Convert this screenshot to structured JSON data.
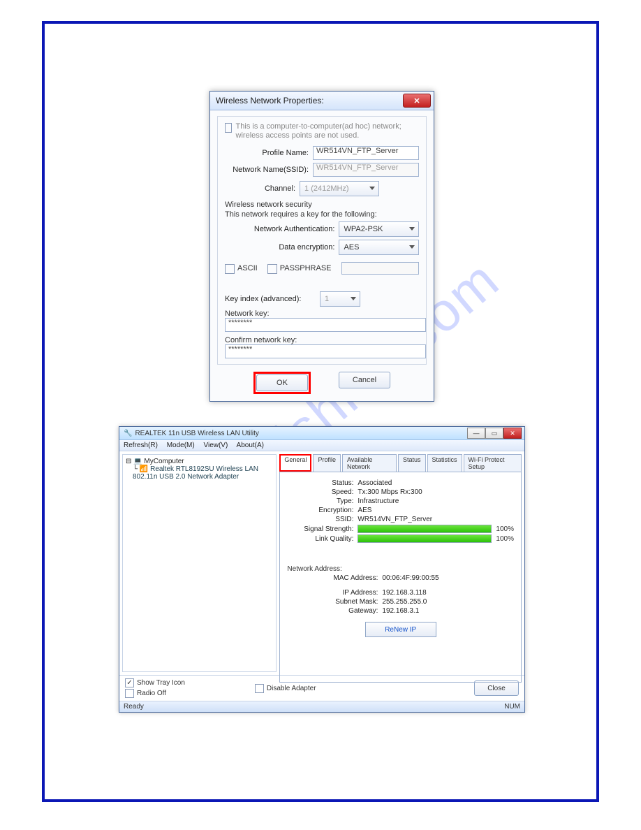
{
  "dlg1": {
    "title": "Wireless Network Properties:",
    "adhoc_text": "This is a computer-to-computer(ad hoc) network; wireless access points are not used.",
    "profile_label": "Profile Name:",
    "profile_value": "WR514VN_FTP_Server",
    "ssid_label": "Network Name(SSID):",
    "ssid_value": "WR514VN_FTP_Server",
    "channel_label": "Channel:",
    "channel_value": "1 (2412MHz)",
    "sec_heading": "Wireless network security",
    "sec_subtext": "This network requires a key for the following:",
    "auth_label": "Network Authentication:",
    "auth_value": "WPA2-PSK",
    "enc_label": "Data encryption:",
    "enc_value": "AES",
    "ascii_label": "ASCII",
    "pass_label": "PASSPHRASE",
    "keyidx_label": "Key index (advanced):",
    "keyidx_value": "1",
    "netkey_label": "Network key:",
    "netkey_value": "********",
    "confirm_label": "Confirm network key:",
    "confirm_value": "********",
    "ok": "OK",
    "cancel": "Cancel"
  },
  "dlg2": {
    "title": "REALTEK 11n USB Wireless LAN Utility",
    "menu": [
      "Refresh(R)",
      "Mode(M)",
      "View(V)",
      "About(A)"
    ],
    "tree_root": "MyComputer",
    "tree_child": "Realtek RTL8192SU Wireless LAN 802.11n USB 2.0 Network Adapter",
    "tabs": [
      "General",
      "Profile",
      "Available Network",
      "Status",
      "Statistics",
      "Wi-Fi Protect Setup"
    ],
    "stats": {
      "status_k": "Status:",
      "status_v": "Associated",
      "speed_k": "Speed:",
      "speed_v": "Tx:300 Mbps Rx:300",
      "type_k": "Type:",
      "type_v": "Infrastructure",
      "enc_k": "Encryption:",
      "enc_v": "AES",
      "ssid_k": "SSID:",
      "ssid_v": "WR514VN_FTP_Server",
      "sig_k": "Signal Strength:",
      "sig_pct": "100%",
      "lq_k": "Link Quality:",
      "lq_pct": "100%"
    },
    "netaddr_heading": "Network Address:",
    "mac_k": "MAC Address:",
    "mac_v": "00:06:4F:99:00:55",
    "ip_k": "IP Address:",
    "ip_v": "192.168.3.118",
    "mask_k": "Subnet Mask:",
    "mask_v": "255.255.255.0",
    "gw_k": "Gateway:",
    "gw_v": "192.168.3.1",
    "renew": "ReNew IP",
    "show_tray": "Show Tray Icon",
    "radio_off": "Radio Off",
    "disable_adapter": "Disable Adapter",
    "close": "Close",
    "status_ready": "Ready",
    "status_num": "NUM"
  },
  "watermark": "manualshive.com"
}
